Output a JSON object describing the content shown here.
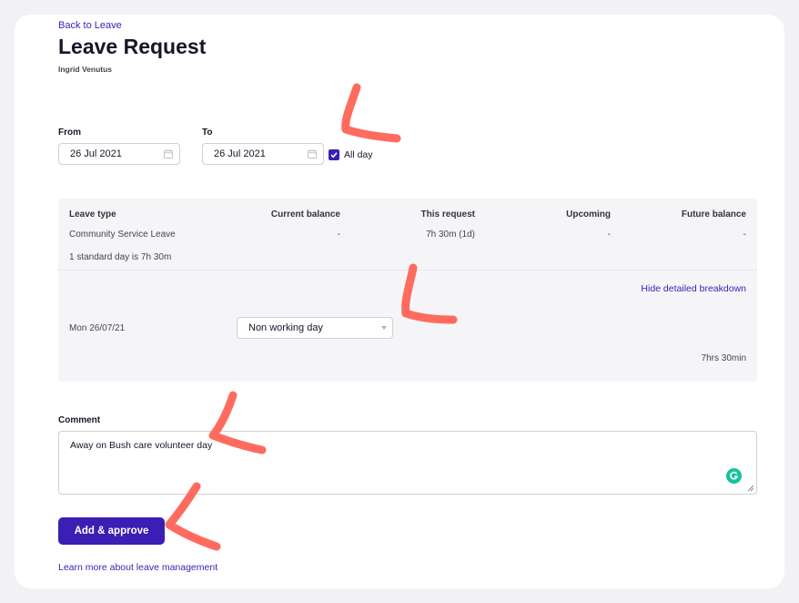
{
  "header": {
    "back_link": "Back to Leave",
    "title": "Leave Request",
    "user_name": "Ingrid Venutus"
  },
  "dates": {
    "from_label": "From",
    "from_value": "26 Jul 2021",
    "to_label": "To",
    "to_value": "26 Jul 2021",
    "all_day_label": "All day",
    "all_day_checked": true
  },
  "breakdown": {
    "columns": [
      "Leave type",
      "Current balance",
      "This request",
      "Upcoming",
      "Future balance"
    ],
    "row": [
      "Community Service Leave",
      "-",
      "7h 30m (1d)",
      "-",
      "-"
    ],
    "standard_day_note": "1 standard day is 7h 30m",
    "hide_link": "Hide detailed breakdown",
    "day": {
      "date": "Mon 26/07/21",
      "selection": "Non working day",
      "total": "7hrs 30min"
    }
  },
  "comment": {
    "label": "Comment",
    "value": "Away on Bush care volunteer day"
  },
  "actions": {
    "add_approve": "Add & approve",
    "learn_more": "Learn more about leave management"
  },
  "colors": {
    "accent": "#3b1fb4",
    "annotation": "#ff6b5e",
    "grammarly": "#15c39a"
  }
}
